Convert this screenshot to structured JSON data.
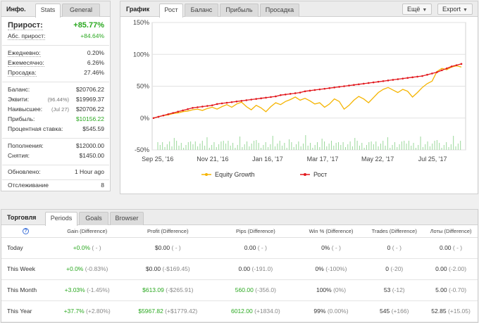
{
  "stats_panel": {
    "title": "Инфо.",
    "tabs": [
      "Stats",
      "General"
    ],
    "active_tab": "Stats",
    "growth_label": "Прирост:",
    "growth_value": "+85.77%",
    "abs_growth_label": "Абс. прирост:",
    "abs_growth_value": "+84.64%",
    "daily_label": "Ежедневно:",
    "daily_value": "0.20%",
    "monthly_label": "Ежемесячно:",
    "monthly_value": "6.26%",
    "drawdown_label": "Просадка:",
    "drawdown_value": "27.46%",
    "balance_label": "Баланс:",
    "balance_value": "$20706.22",
    "equity_label": "Эквити:",
    "equity_note": "(96.44%)",
    "equity_value": "$19969.37",
    "highest_label": "Наивысшее:",
    "highest_note": "(Jul 27)",
    "highest_value": "$20706.22",
    "profit_label": "Прибыль:",
    "profit_value": "$10156.22",
    "interest_label": "Процентная ставка:",
    "interest_value": "$545.59",
    "deposits_label": "Пополнения:",
    "deposits_value": "$12000.00",
    "withdrawals_label": "Снятия:",
    "withdrawals_value": "$1450.00",
    "updated_label": "Обновлено:",
    "updated_value": "1 Hour ago",
    "tracking_label": "Отслеживание",
    "tracking_value": "8"
  },
  "chart_panel": {
    "title": "График",
    "tabs": [
      "Рост",
      "Баланс",
      "Прибыль",
      "Просадка"
    ],
    "active_tab": "Рост",
    "btn_more": "Ещё",
    "btn_export": "Export"
  },
  "chart_data": {
    "type": "line",
    "y_tick_labels": [
      "150%",
      "100%",
      "50%",
      "0%",
      "-50%"
    ],
    "ylim": [
      -50,
      150
    ],
    "x_tick_labels": [
      "Sep 25, '16",
      "Nov 21, '16",
      "Jan 16, '17",
      "Mar 17, '17",
      "May 22, '17",
      "Jul 25, '17"
    ],
    "grid": true,
    "legend_position": "bottom",
    "series": [
      {
        "name": "Equity Growth",
        "color": "#f5b400",
        "values": [
          0,
          2,
          4,
          5,
          7,
          8,
          10,
          11,
          13,
          14,
          12,
          15,
          17,
          14,
          18,
          21,
          17,
          22,
          25,
          18,
          13,
          20,
          16,
          10,
          18,
          24,
          21,
          26,
          29,
          33,
          28,
          31,
          27,
          22,
          24,
          17,
          22,
          30,
          26,
          14,
          20,
          28,
          34,
          30,
          24,
          32,
          40,
          45,
          48,
          44,
          40,
          45,
          42,
          33,
          40,
          48,
          54,
          58,
          73,
          78,
          76,
          80,
          82,
          80
        ]
      },
      {
        "name": "Рост",
        "color": "#e2191e",
        "values": [
          0,
          2,
          4,
          6,
          8,
          10,
          12,
          14,
          16,
          17,
          18,
          19,
          20,
          22,
          23,
          24,
          25,
          26,
          27,
          28,
          29,
          30,
          31,
          32,
          33,
          34,
          36,
          37,
          38,
          39,
          40,
          42,
          43,
          44,
          45,
          46,
          47,
          48,
          49,
          50,
          51,
          52,
          53,
          54,
          55,
          56,
          57,
          58,
          59,
          60,
          61,
          62,
          63,
          64,
          65,
          66,
          68,
          70,
          72,
          75,
          78,
          81,
          83,
          85
        ]
      }
    ],
    "volume_bars": true
  },
  "trading_panel": {
    "title": "Торговля",
    "tabs": [
      "Periods",
      "Goals",
      "Browser"
    ],
    "active_tab": "Periods",
    "help_icon": "?",
    "columns": [
      "Gain (Difference)",
      "Profit (Difference)",
      "Pips (Difference)",
      "Win % (Difference)",
      "Trades (Difference)",
      "Лоты (Difference)"
    ],
    "rows": [
      {
        "label": "Today",
        "gain": "+0.0%",
        "gain_diff": "( - )",
        "profit": "$0.00",
        "profit_diff": "( - )",
        "pips": "0.00",
        "pips_diff": "( - )",
        "win": "0%",
        "win_diff": "( - )",
        "trades": "0",
        "trades_diff": "( - )",
        "lots": "0.00",
        "lots_diff": "( - )"
      },
      {
        "label": "This Week",
        "gain": "+0.0%",
        "gain_diff": "(-0.83%)",
        "profit": "$0.00",
        "profit_diff": "(-$169.45)",
        "pips": "0.00",
        "pips_diff": "(-191.0)",
        "win": "0%",
        "win_diff": "(-100%)",
        "trades": "0",
        "trades_diff": "(-20)",
        "lots": "0.00",
        "lots_diff": "(-2.00)"
      },
      {
        "label": "This Month",
        "gain": "+3.03%",
        "gain_diff": "(-1.45%)",
        "profit": "$613.09",
        "profit_diff": "(-$265.91)",
        "pips": "560.00",
        "pips_diff": "(-356.0)",
        "win": "100%",
        "win_diff": "(0%)",
        "trades": "53",
        "trades_diff": "(-12)",
        "lots": "5.00",
        "lots_diff": "(-0.70)"
      },
      {
        "label": "This Year",
        "gain": "+37.7%",
        "gain_diff": "(+2.80%)",
        "profit": "$5967.82",
        "profit_diff": "(+$1779.42)",
        "pips": "6012.00",
        "pips_diff": "(+1834.0)",
        "win": "99%",
        "win_diff": "(0.00%)",
        "trades": "545",
        "trades_diff": "(+166)",
        "lots": "52.85",
        "lots_diff": "(+15.05)"
      }
    ]
  }
}
